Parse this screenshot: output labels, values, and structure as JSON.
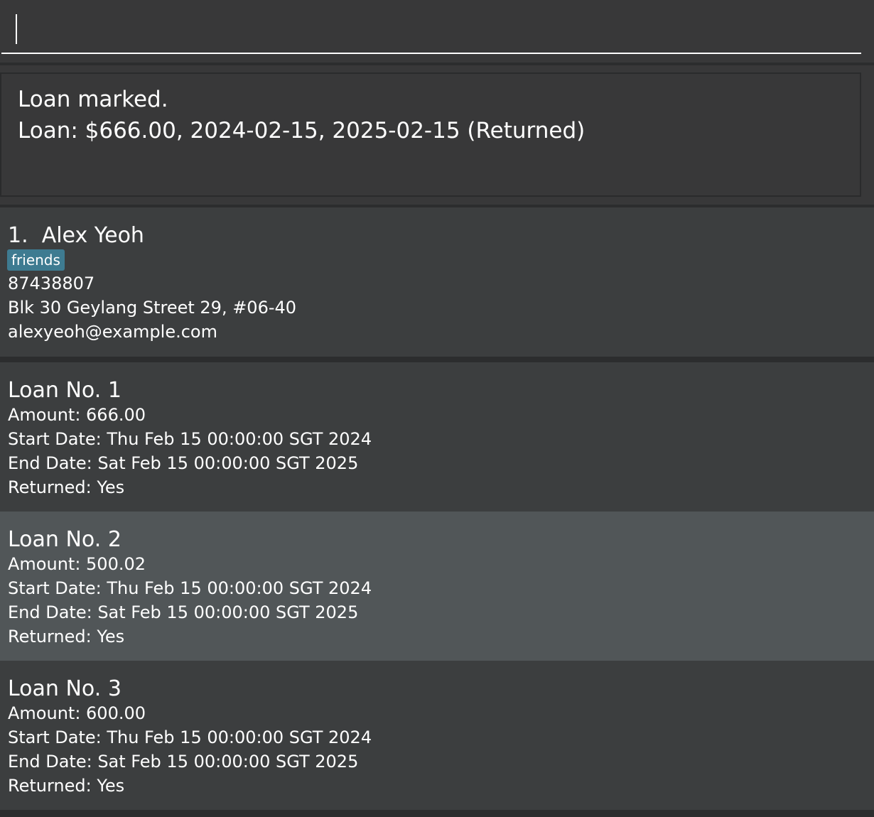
{
  "command": {
    "value": "",
    "placeholder": ""
  },
  "result": {
    "line1": "Loan marked.",
    "line2": "Loan: $666.00, 2024-02-15, 2025-02-15 (Returned)"
  },
  "person": {
    "index": "1.",
    "name": "Alex Yeoh",
    "tag": "friends",
    "phone": "87438807",
    "address": "Blk 30 Geylang Street 29, #06-40",
    "email": "alexyeoh@example.com"
  },
  "loans": [
    {
      "title": "Loan No. 1",
      "amount": "Amount: 666.00",
      "start": "Start Date: Thu Feb 15 00:00:00 SGT 2024",
      "end": "End Date: Sat Feb 15 00:00:00 SGT 2025",
      "returned": "Returned: Yes"
    },
    {
      "title": "Loan No. 2",
      "amount": "Amount: 500.02",
      "start": "Start Date: Thu Feb 15 00:00:00 SGT 2024",
      "end": "End Date: Sat Feb 15 00:00:00 SGT 2025",
      "returned": "Returned: Yes"
    },
    {
      "title": "Loan No. 3",
      "amount": "Amount: 600.00",
      "start": "Start Date: Thu Feb 15 00:00:00 SGT 2024",
      "end": "End Date: Sat Feb 15 00:00:00 SGT 2025",
      "returned": "Returned: Yes"
    }
  ],
  "colors": {
    "background": "#2c2d2e",
    "panel": "#383839",
    "card": "#3c3e3f",
    "selected_card": "#515658",
    "tag": "#3e7b91",
    "text": "#ffffff"
  }
}
